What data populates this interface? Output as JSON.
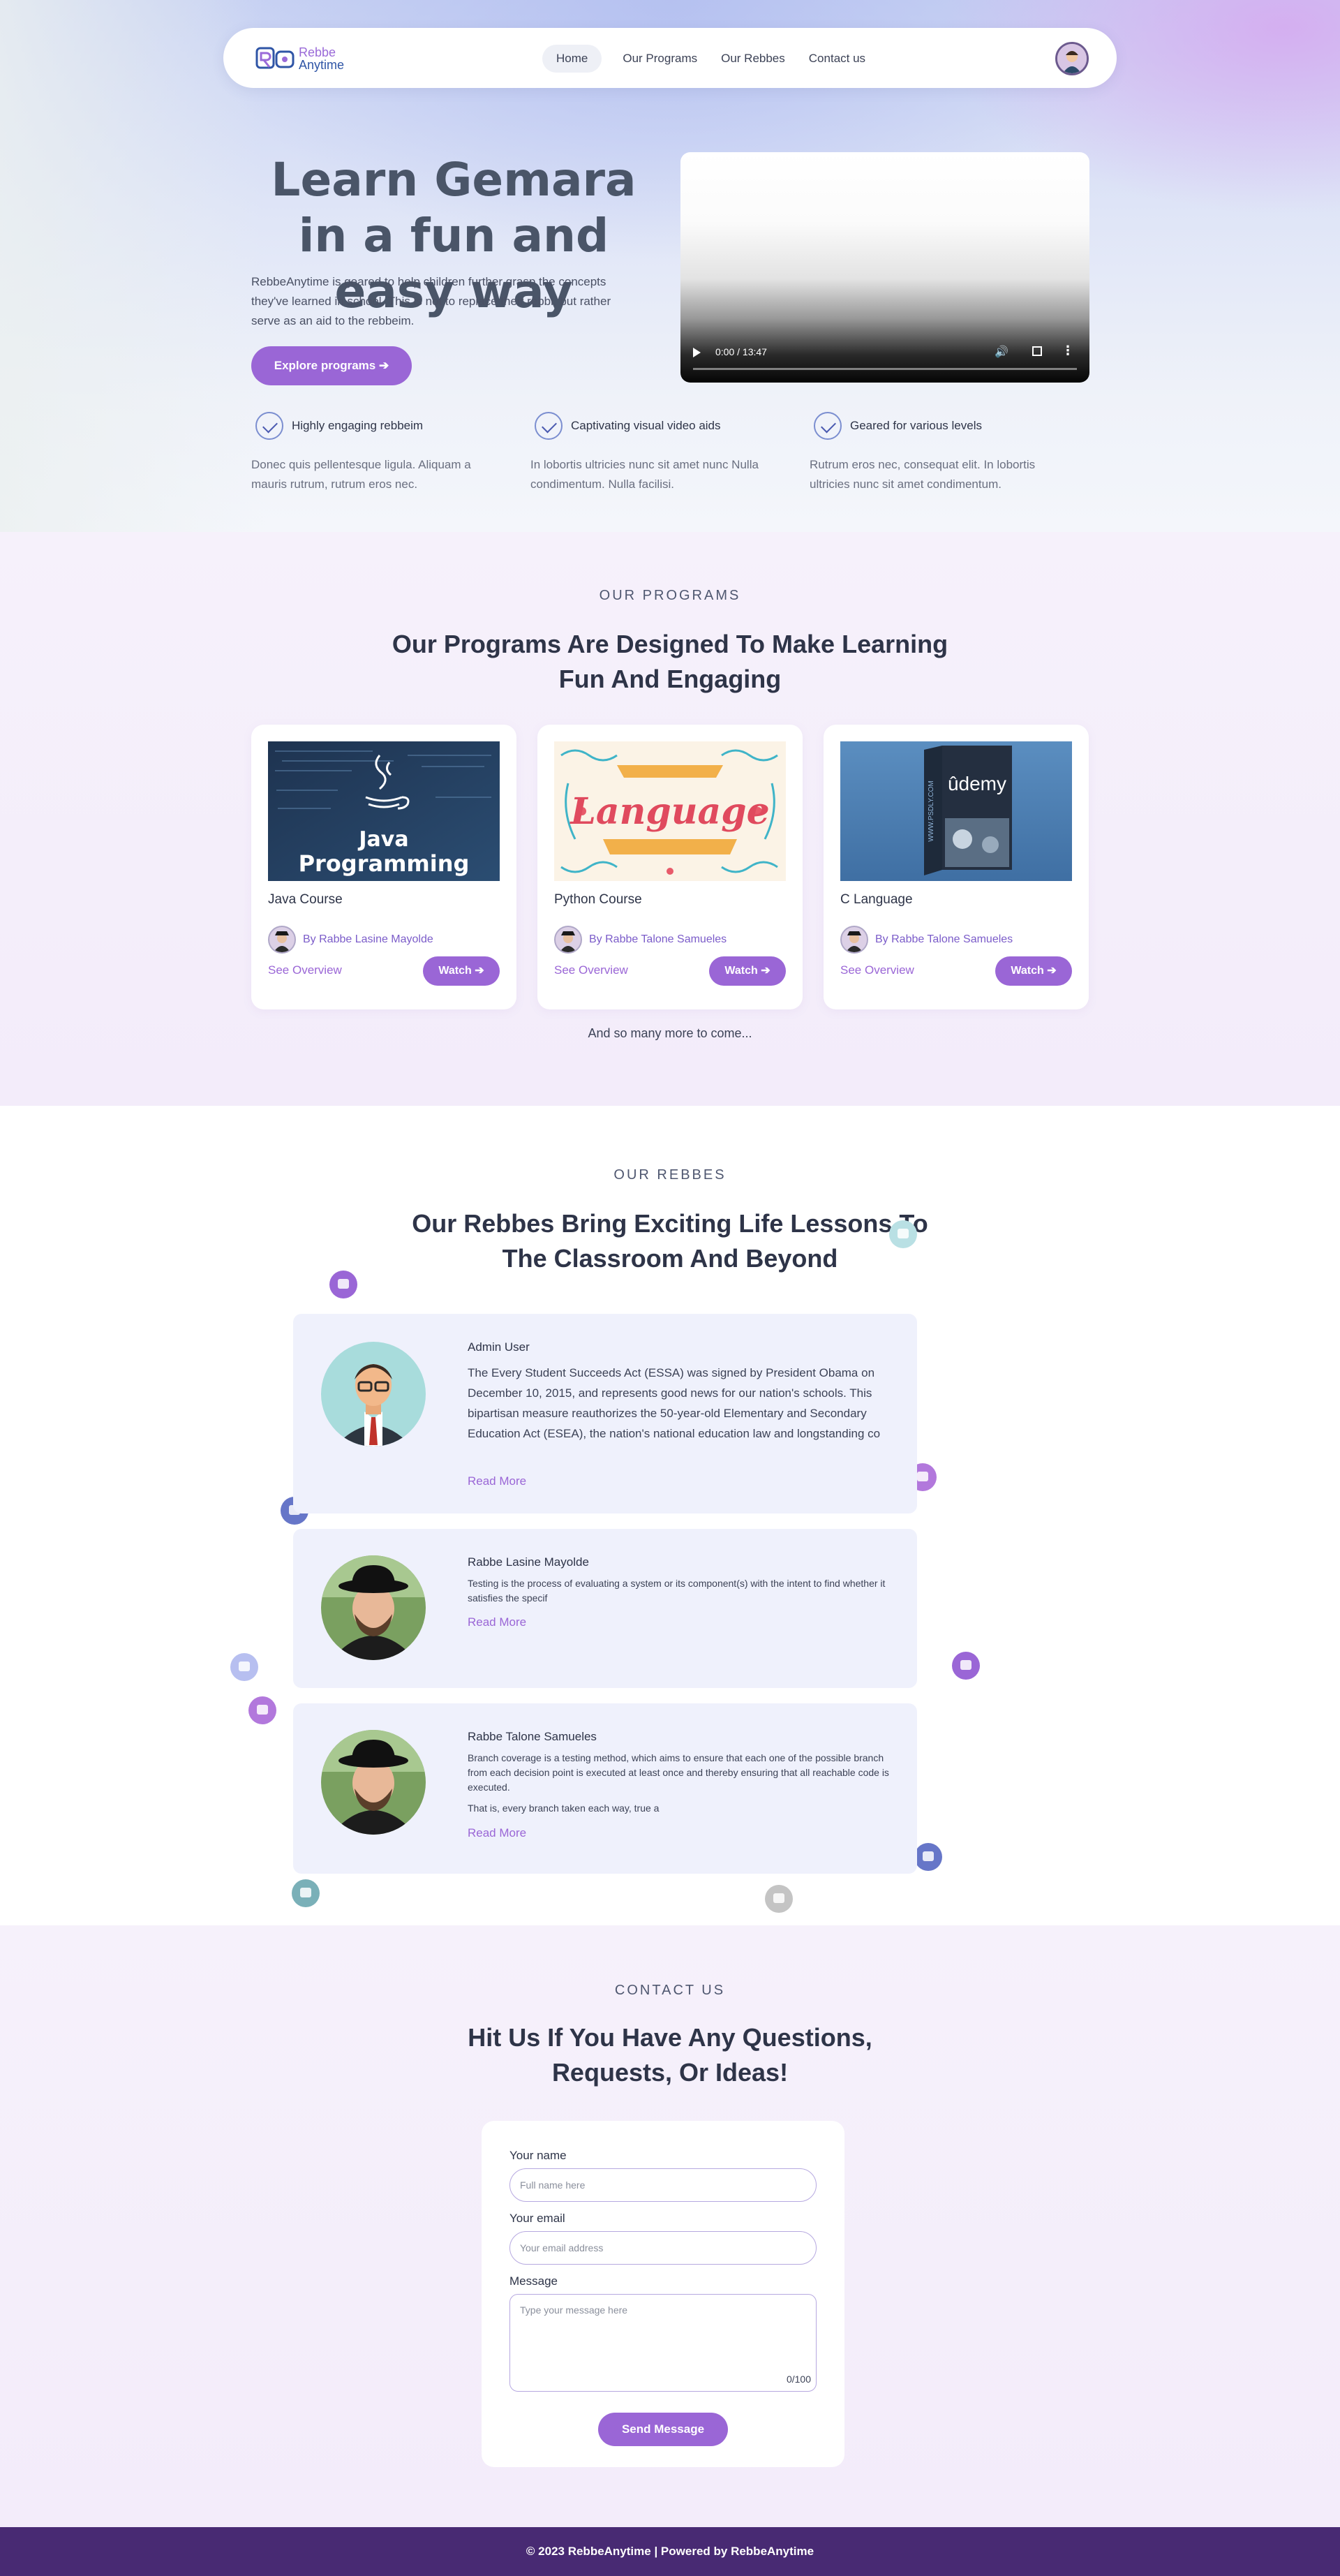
{
  "nav": {
    "logo_line1": "Rebbe",
    "logo_line2": "Anytime",
    "links": [
      "Home",
      "Our Programs",
      "Our Rebbes",
      "Contact us"
    ]
  },
  "hero": {
    "title": "Learn Gemara in a fun and easy way",
    "description": "RebbeAnytime is geared to help children further grasp the concepts they've learned in school. This is not to replace their rebbi, but rather serve as an aid to the rebbeim.",
    "button": "Explore programs",
    "video_time": "0:00 / 13:47",
    "video_progress": 0
  },
  "features": [
    {
      "title": "Highly engaging rebbeim",
      "text": "Donec quis pellentesque ligula. Aliquam a mauris rutrum, rutrum eros nec."
    },
    {
      "title": "Captivating visual video aids",
      "text": "In lobortis ultricies nunc sit amet nunc Nulla condimentum. Nulla facilisi."
    },
    {
      "title": "Geared for various levels",
      "text": "Rutrum eros nec, consequat elit. In lobortis ultricies nunc sit amet condimentum."
    }
  ],
  "programs": {
    "kicker": "OUR PROGRAMS",
    "title": "Our Programs Are Designed To Make Learning Fun And Engaging",
    "cards": [
      {
        "title": "Java Course",
        "image_text_1": "Java",
        "image_text_2": "Programming",
        "author": "By Rabbe Lasine Mayolde",
        "overview": "See Overview",
        "watch": "Watch"
      },
      {
        "title": "Python Course",
        "image_text_1": "Language",
        "author": "By Rabbe Talone Samueles",
        "overview": "See Overview",
        "watch": "Watch"
      },
      {
        "title": "C Language",
        "image_text_1": "ûdemy",
        "image_text_2": "WWW.PSDLY.COM",
        "author": "By Rabbe Talone Samueles",
        "overview": "See Overview",
        "watch": "Watch"
      }
    ],
    "more": "And so many more to come..."
  },
  "rebbes": {
    "kicker": "OUR REBBES",
    "title": "Our Rebbes Bring Exciting Life Lessons To The Classroom And Beyond",
    "items": [
      {
        "name": "Admin User",
        "text": "The Every Student Succeeds Act (ESSA) was signed by President Obama on December 10, 2015, and represents good news for our nation's schools. This bipartisan measure reauthorizes the 50-year-old Elementary and Secondary Education Act (ESEA), the nation's national education law and longstanding co",
        "more": "Read More"
      },
      {
        "name": "Rabbe Lasine Mayolde",
        "text": "Testing is the process of evaluating a system or its component(s) with the intent to find whether it satisfies the specif",
        "more": "Read More"
      },
      {
        "name": "Rabbe Talone Samueles",
        "text": "Branch coverage is a testing method, which aims to ensure that each one of the possible branch from each decision point is executed at least once and thereby ensuring that all reachable code is executed.",
        "text2": "That is, every branch taken each way, true a",
        "more": "Read More"
      }
    ]
  },
  "contact": {
    "kicker": "CONTACT US",
    "title": "Hit Us If You Have Any Questions, Requests, Or Ideas!",
    "name_label": "Your name",
    "name_placeholder": "Full name here",
    "email_label": "Your email",
    "email_placeholder": "Your email address",
    "message_label": "Message",
    "message_placeholder": "Type your message here",
    "counter": "0/100",
    "send": "Send Message"
  },
  "footer": {
    "text": "© 2023 RebbeAnytime | Powered by RebbeAnytime"
  },
  "colors": {
    "accent": "#9a66d6",
    "footer": "#482a73",
    "card_bg": "#eff1fc"
  }
}
